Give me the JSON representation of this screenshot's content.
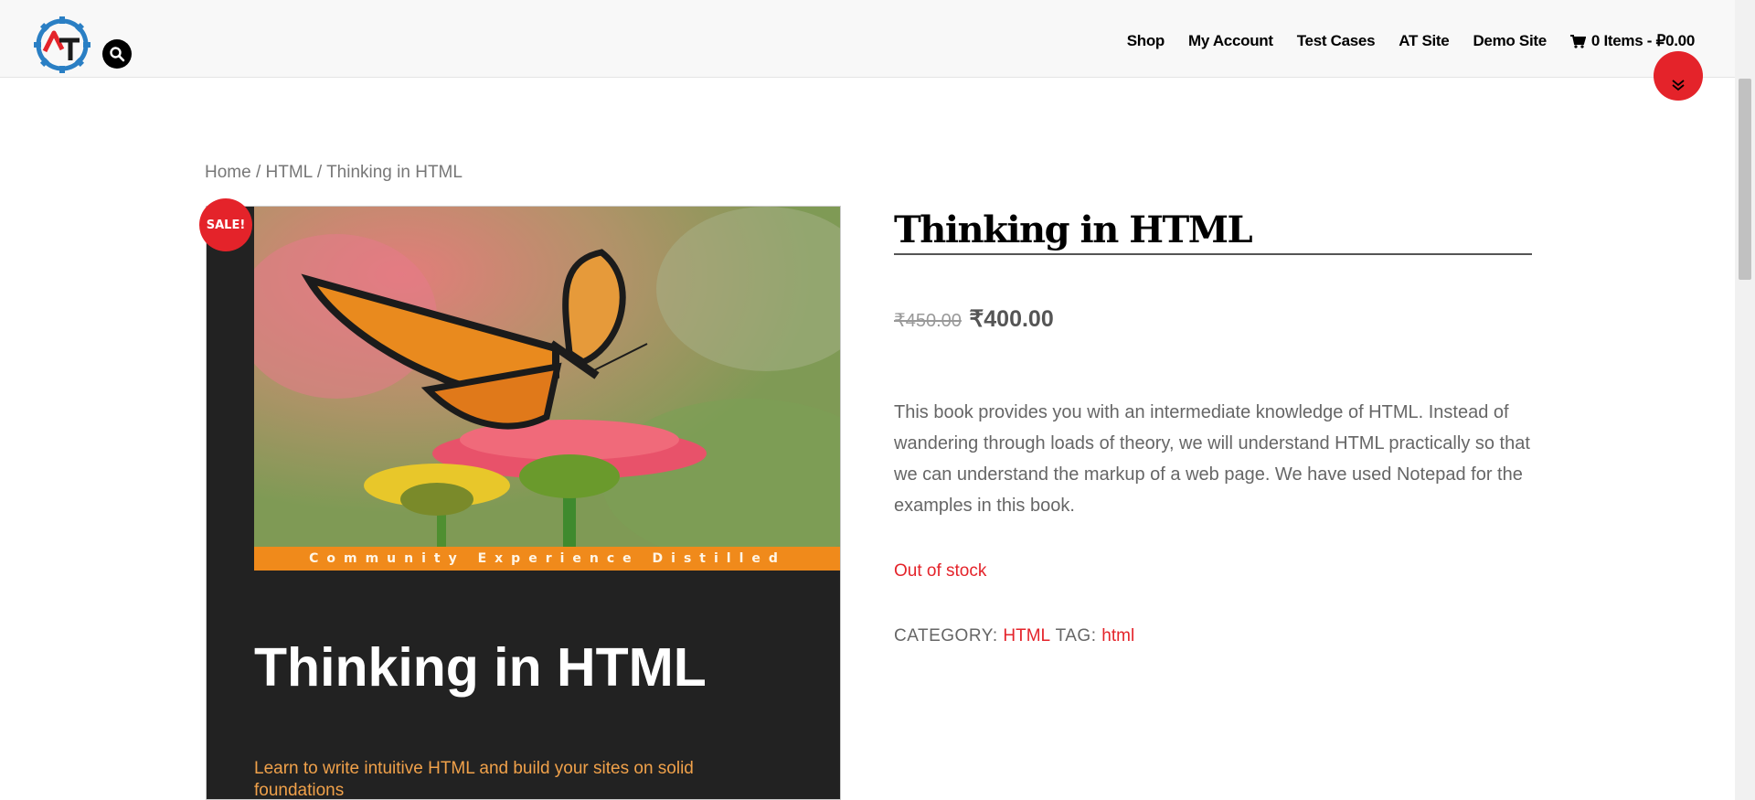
{
  "header": {
    "nav": [
      {
        "label": "Shop"
      },
      {
        "label": "My Account"
      },
      {
        "label": "Test Cases"
      },
      {
        "label": "AT Site"
      },
      {
        "label": "Demo Site"
      }
    ],
    "cart_label": "0 Items - ₽0.00",
    "cart_icon": "cart-icon",
    "search_icon": "search-icon"
  },
  "breadcrumb": {
    "home": "Home",
    "sep": "/",
    "category": "HTML",
    "current": "Thinking in HTML"
  },
  "product": {
    "sale_badge": "SALE!",
    "cover": {
      "band_text": "Community Experience Distilled",
      "title": "Thinking in HTML",
      "subtitle": "Learn to write intuitive HTML and build your sites on solid foundations"
    },
    "title": "Thinking in HTML",
    "old_price": "₹450.00",
    "price": "₹400.00",
    "description": "This book provides you with an intermediate knowledge of HTML. Instead of wandering through loads of theory, we will understand HTML practically so that we can understand the markup of a web page. We have used Notepad for the examples in this book.",
    "stock_status": "Out of stock",
    "category_label": "CATEGORY:",
    "category_value": "HTML",
    "tag_label": "TAG:",
    "tag_value": "html"
  },
  "colors": {
    "accent": "#e4232a",
    "header_bg": "#f8f8f8",
    "text": "#666666"
  }
}
